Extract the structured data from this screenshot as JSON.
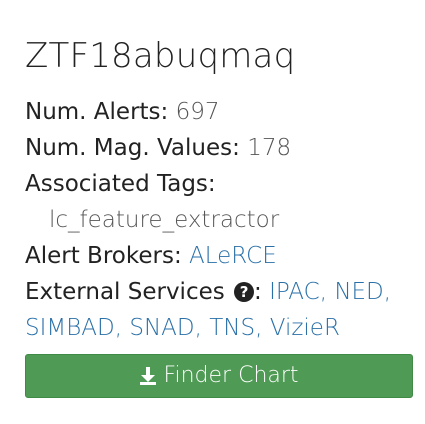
{
  "object": {
    "name": "ZTF18abuqmaq"
  },
  "alerts": {
    "label": "Num. Alerts:",
    "value": "697"
  },
  "mag_values": {
    "label": "Num. Mag. Values:",
    "value": "178"
  },
  "tags": {
    "label": "Associated Tags:",
    "items": [
      "lc_feature_extractor"
    ]
  },
  "brokers": {
    "label": "Alert Brokers:",
    "items": [
      "ALeRCE"
    ]
  },
  "external_services": {
    "label": "External Services",
    "items": [
      "IPAC",
      "NED",
      "SIMBAD",
      "SNAD",
      "TNS",
      "VizieR"
    ]
  },
  "finder_chart": {
    "label": "Finder Chart"
  },
  "colors": {
    "link": "#2a70a8",
    "button": "#4f9a54"
  }
}
